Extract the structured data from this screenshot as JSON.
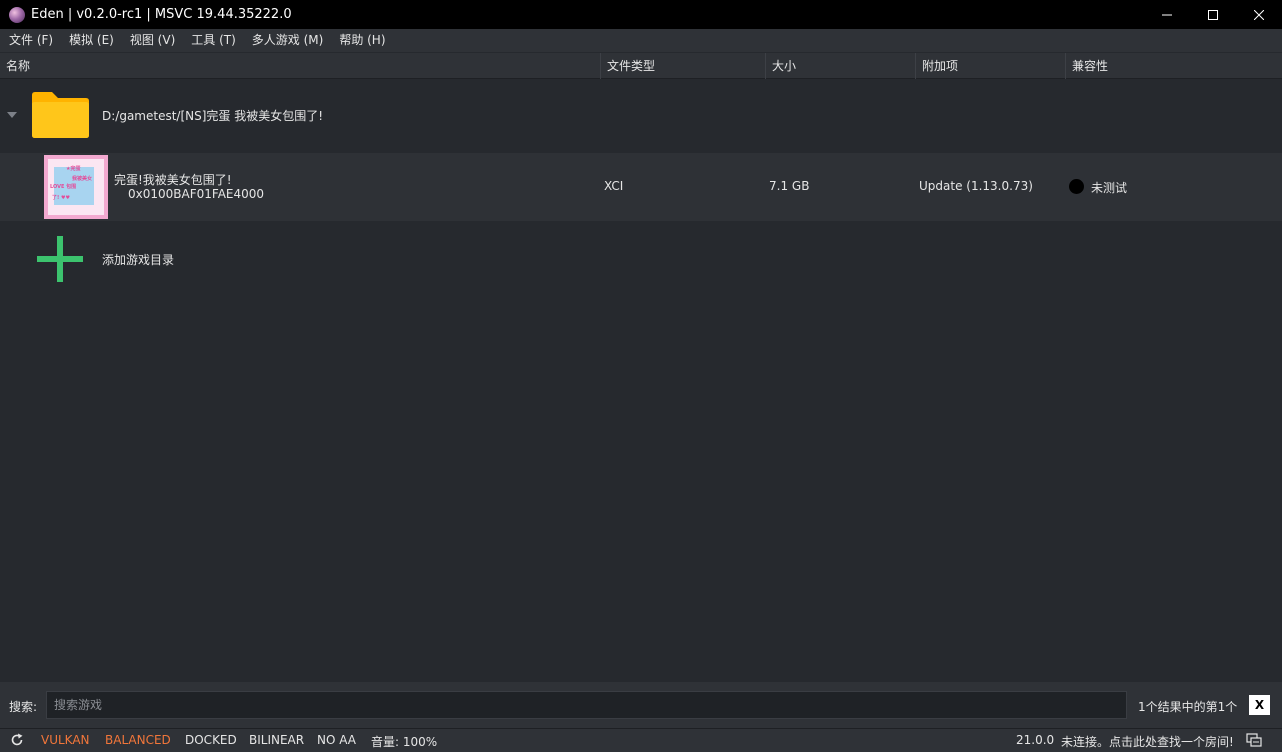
{
  "window": {
    "title": "Eden | v0.2.0-rc1 | MSVC 19.44.35222.0"
  },
  "menu": {
    "items": [
      "文件 (F)",
      "模拟 (E)",
      "视图 (V)",
      "工具 (T)",
      "多人游戏 (M)",
      "帮助 (H)"
    ]
  },
  "columns": [
    "名称",
    "文件类型",
    "大小",
    "附加项",
    "兼容性"
  ],
  "folder": {
    "path": "D:/gametest/[NS]完蛋 我被美女包围了!"
  },
  "game": {
    "name": "完蛋!我被美女包围了!",
    "title_id": "0x0100BAF01FAE4000",
    "file_type": "XCI",
    "size": "7.1 GB",
    "addons": "Update (1.13.0.73)",
    "compatibility": "未测试",
    "compat_color": "#000000"
  },
  "add_dir": {
    "label": "添加游戏目录"
  },
  "search": {
    "label": "搜索:",
    "placeholder": "搜索游戏",
    "value": "",
    "result": "1个结果中的第1个",
    "clear_label": "X"
  },
  "status": {
    "api": "VULKAN",
    "gpu_accuracy": "BALANCED",
    "dock_mode": "DOCKED",
    "filter": "BILINEAR",
    "aa": "NO AA",
    "volume": "音量: 100%",
    "version": "21.0.0",
    "room": "未连接。点击此处查找一个房间!"
  },
  "colors": {
    "accent_orange": "#f1763a",
    "folder_yellow": "#ffc61a",
    "plus_green": "#3cc36e",
    "background": "#26292e"
  },
  "icons": {
    "app": "eden-logo-icon",
    "folder": "folder-icon",
    "add": "plus-icon",
    "refresh": "refresh-icon",
    "room": "multiplayer-room-icon"
  }
}
